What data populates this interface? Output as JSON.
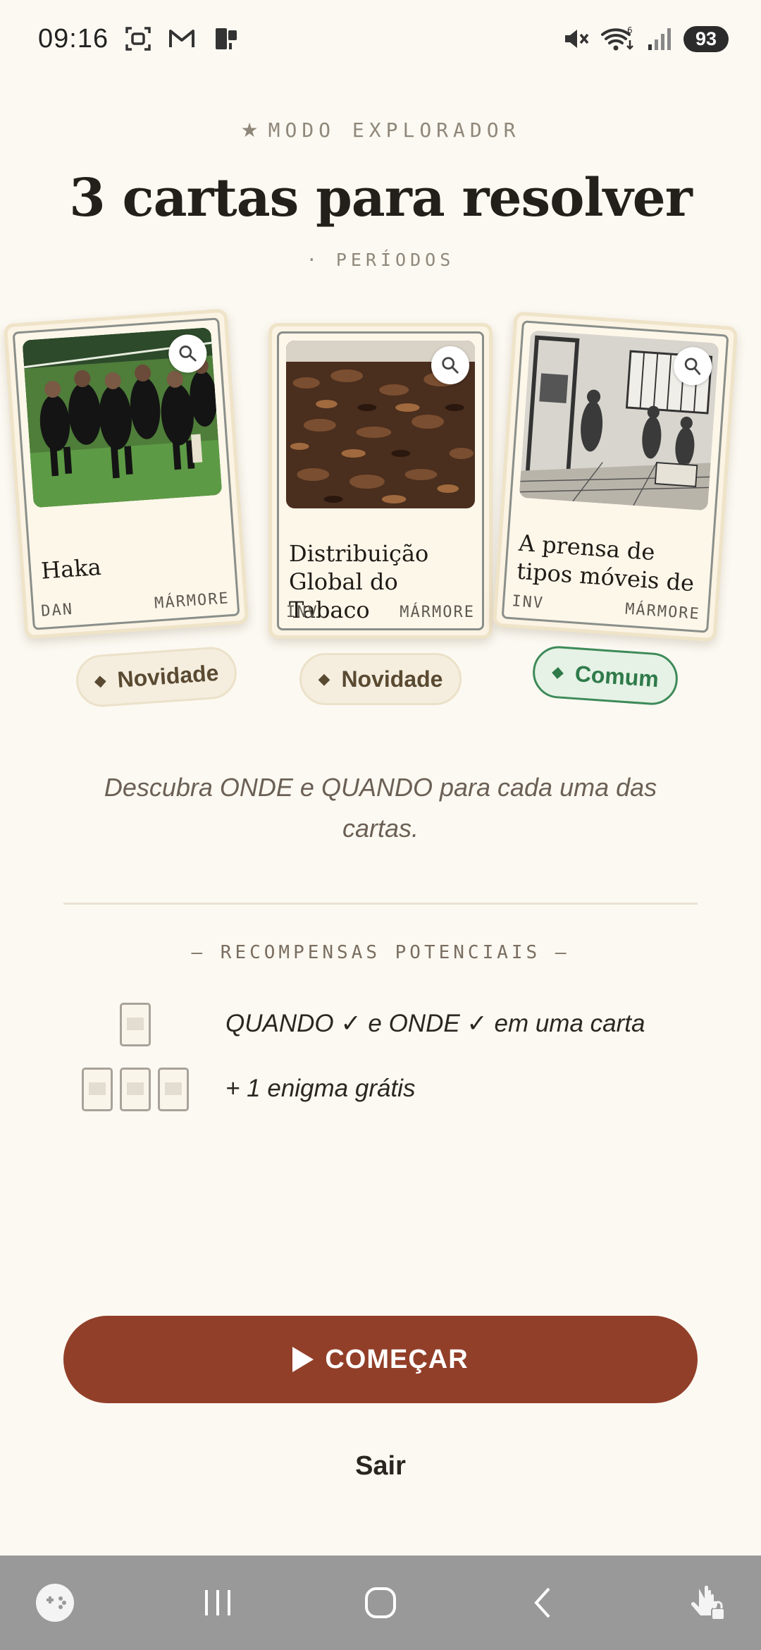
{
  "status_bar": {
    "time": "09:16",
    "left_icons": [
      "screenshot-icon",
      "gmail-icon",
      "clipboard-icon"
    ],
    "right_icons": [
      "mute-icon",
      "wifi-icon",
      "signal-icon"
    ],
    "battery": "93"
  },
  "header": {
    "mode_icon": "star-icon",
    "mode_label": "MODO EXPLORADOR",
    "title": "3 cartas para resolver",
    "subtitle": "· PERÍODOS"
  },
  "cards": [
    {
      "title": "Haka",
      "tag_left": "DAN",
      "tag_right": "MÁRMORE",
      "image": "rugby-team-haka-photo",
      "rarity": "Novidade",
      "rarity_color": "#5a4a32"
    },
    {
      "title": "Distribuição Global do Tabaco",
      "tag_left": "INV",
      "tag_right": "MÁRMORE",
      "image": "tobacco-leaves-photo",
      "rarity": "Novidade",
      "rarity_color": "#5a4a32"
    },
    {
      "title": "A prensa de tipos móveis de ...",
      "tag_left": "INV",
      "tag_right": "MÁRMORE",
      "image": "printing-press-engraving",
      "rarity": "Comum",
      "rarity_color": "#2f7a4a"
    }
  ],
  "instruction": "Descubra ONDE e QUANDO para cada uma das cartas.",
  "rewards": {
    "heading": "— RECOMPENSAS POTENCIAIS —",
    "items": [
      {
        "cards": 1,
        "text": "QUANDO ✓ e ONDE ✓ em uma carta"
      },
      {
        "cards": 3,
        "text": "+ 1 enigma grátis"
      }
    ]
  },
  "actions": {
    "start_label": "COMEÇAR",
    "exit_label": "Sair"
  },
  "nav_bar": {
    "buttons": [
      "game-launcher-icon",
      "recent-apps-icon",
      "home-icon",
      "back-icon",
      "touch-lock-icon"
    ]
  },
  "colors": {
    "background": "#fcf9f2",
    "primary_button": "#923f29",
    "common_green": "#3d8a58"
  }
}
